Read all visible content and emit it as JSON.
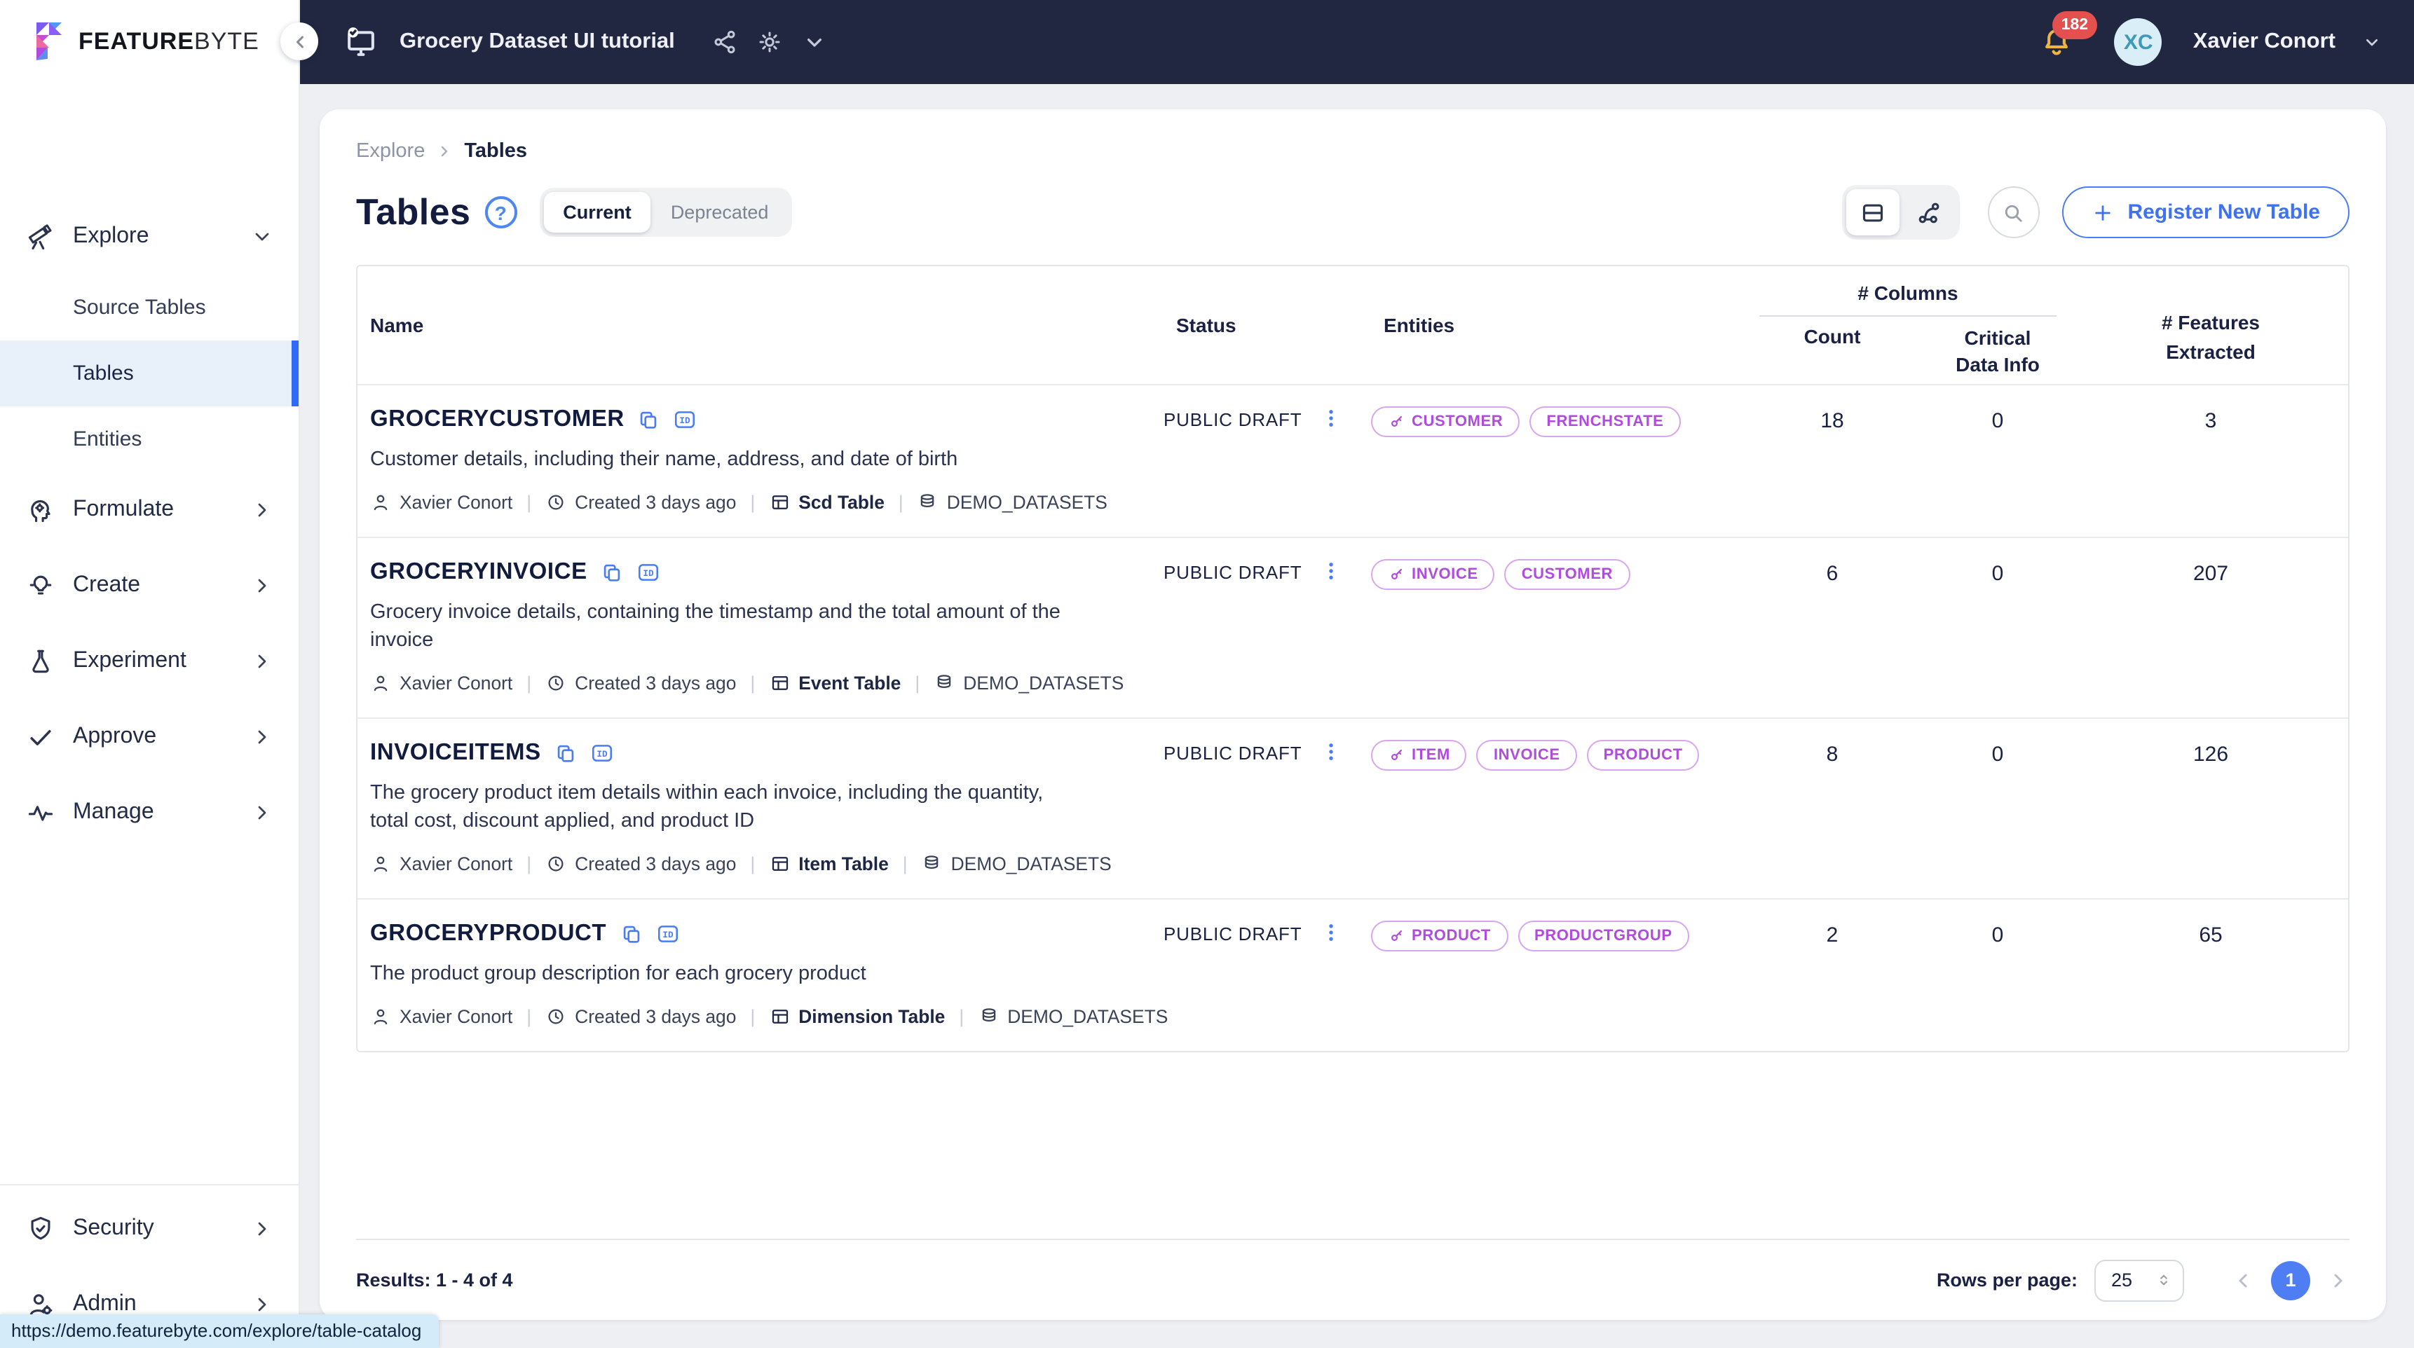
{
  "topbar": {
    "workspace_title": "Grocery Dataset UI tutorial",
    "notification_count": "182",
    "user_initials": "XC",
    "user_name": "Xavier Conort"
  },
  "sidebar": {
    "logo_bold": "FEATURE",
    "logo_light": "BYTE",
    "explore_label": "Explore",
    "explore_children": [
      "Source Tables",
      "Tables",
      "Entities"
    ],
    "items": [
      {
        "label": "Formulate"
      },
      {
        "label": "Create"
      },
      {
        "label": "Experiment"
      },
      {
        "label": "Approve"
      },
      {
        "label": "Manage"
      }
    ],
    "bottom": [
      {
        "label": "Security"
      },
      {
        "label": "Admin"
      }
    ]
  },
  "breadcrumb": {
    "parent": "Explore",
    "current": "Tables"
  },
  "page": {
    "title": "Tables",
    "filter_current": "Current",
    "filter_deprecated": "Deprecated",
    "register_button": "Register New Table"
  },
  "table": {
    "headers": {
      "name": "Name",
      "status": "Status",
      "entities": "Entities",
      "columns_group": "# Columns",
      "count": "Count",
      "critical_line1": "Critical",
      "critical_line2": "Data Info",
      "features_line1": "# Features",
      "features_line2": "Extracted"
    },
    "rows": [
      {
        "name": "GROCERYCUSTOMER",
        "description": "Customer details, including their name, address, and date of birth",
        "owner": "Xavier Conort",
        "created": "Created 3 days ago",
        "table_type": "Scd Table",
        "dataset": "DEMO_DATASETS",
        "status": "PUBLIC DRAFT",
        "entities": [
          {
            "label": "CUSTOMER",
            "key": true
          },
          {
            "label": "FRENCHSTATE",
            "key": false
          }
        ],
        "count": 18,
        "critical_data_info": 0,
        "features_extracted": 3
      },
      {
        "name": "GROCERYINVOICE",
        "description": "Grocery invoice details, containing the timestamp and the total amount of the invoice",
        "owner": "Xavier Conort",
        "created": "Created 3 days ago",
        "table_type": "Event Table",
        "dataset": "DEMO_DATASETS",
        "status": "PUBLIC DRAFT",
        "entities": [
          {
            "label": "INVOICE",
            "key": true
          },
          {
            "label": "CUSTOMER",
            "key": false
          }
        ],
        "count": 6,
        "critical_data_info": 0,
        "features_extracted": 207
      },
      {
        "name": "INVOICEITEMS",
        "description": "The grocery product item details within each invoice, including the quantity, total cost, discount applied, and product ID",
        "owner": "Xavier Conort",
        "created": "Created 3 days ago",
        "table_type": "Item Table",
        "dataset": "DEMO_DATASETS",
        "status": "PUBLIC DRAFT",
        "entities": [
          {
            "label": "ITEM",
            "key": true
          },
          {
            "label": "INVOICE",
            "key": false
          },
          {
            "label": "PRODUCT",
            "key": false
          }
        ],
        "count": 8,
        "critical_data_info": 0,
        "features_extracted": 126
      },
      {
        "name": "GROCERYPRODUCT",
        "description": "The product group description for each grocery product",
        "owner": "Xavier Conort",
        "created": "Created 3 days ago",
        "table_type": "Dimension Table",
        "dataset": "DEMO_DATASETS",
        "status": "PUBLIC DRAFT",
        "entities": [
          {
            "label": "PRODUCT",
            "key": true
          },
          {
            "label": "PRODUCTGROUP",
            "key": false
          }
        ],
        "count": 2,
        "critical_data_info": 0,
        "features_extracted": 65
      }
    ]
  },
  "footer": {
    "results": "Results: 1 - 4 of 4",
    "rows_per_page_label": "Rows per page:",
    "rows_per_page_value": "25",
    "page": "1"
  },
  "statusbar": {
    "url": "https://demo.featurebyte.com/explore/table-catalog"
  },
  "colors": {
    "topbar_navy": "#222741",
    "accent_blue": "#4a7df5",
    "entity_purple": "#b14be0",
    "badge_red": "#e4504d",
    "bell_yellow": "#efb544",
    "active_item_bg": "#e8f1f9"
  }
}
